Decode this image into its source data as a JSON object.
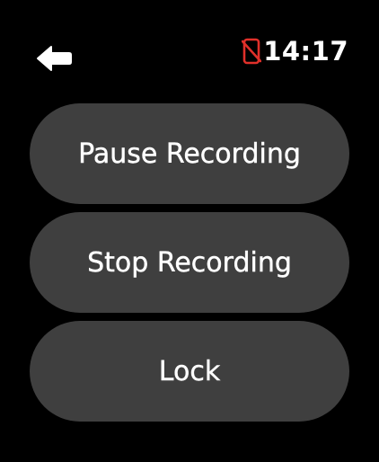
{
  "header": {
    "back_icon": "arrow-left-icon",
    "status_icon": "phone-disconnected-icon",
    "status_icon_color": "#e0302a",
    "time": "14:17"
  },
  "actions": [
    {
      "label": "Pause Recording"
    },
    {
      "label": "Stop Recording"
    },
    {
      "label": "Lock"
    }
  ],
  "colors": {
    "background": "#000000",
    "button_background": "#3f3f3f",
    "text": "#ffffff"
  }
}
